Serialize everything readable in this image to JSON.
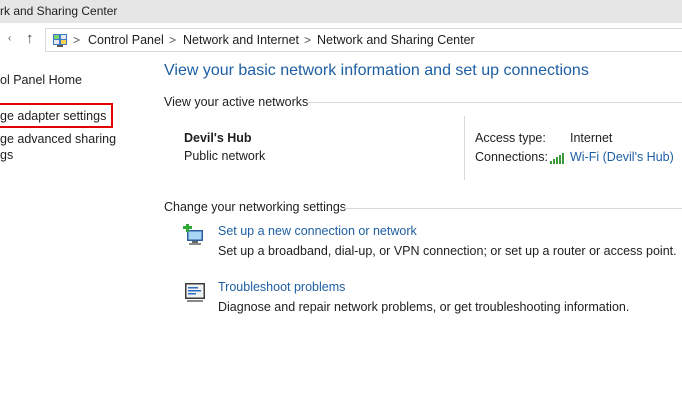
{
  "window": {
    "title": "rk and Sharing Center"
  },
  "address": {
    "crumbs": [
      "Control Panel",
      "Network and Internet",
      "Network and Sharing Center"
    ],
    "separator": ">"
  },
  "nav": {
    "back_glyph": "‹",
    "up_glyph": "↑"
  },
  "sidebar": {
    "items": [
      {
        "label": "ol Panel Home"
      },
      {
        "label": "ge adapter settings"
      },
      {
        "label": "ge advanced sharing"
      },
      {
        "label": "gs"
      }
    ]
  },
  "main": {
    "heading": "View your basic network information and set up connections",
    "active_networks_label": "View your active networks",
    "network": {
      "name": "Devil's Hub",
      "type": "Public network",
      "access_type_label": "Access type:",
      "access_type_value": "Internet",
      "connections_label": "Connections:",
      "connections_value": "Wi-Fi (Devil's Hub)"
    },
    "change_settings_label": "Change your networking settings",
    "tasks": [
      {
        "icon": "new-connection-icon",
        "link": "Set up a new connection or network",
        "description": "Set up a broadband, dial-up, or VPN connection; or set up a router or access point."
      },
      {
        "icon": "troubleshoot-icon",
        "link": "Troubleshoot problems",
        "description": "Diagnose and repair network problems, or get troubleshooting information."
      }
    ]
  },
  "colors": {
    "link": "#1e5fa3",
    "highlight": "#e30000",
    "wifi": "#3a9a3a"
  }
}
